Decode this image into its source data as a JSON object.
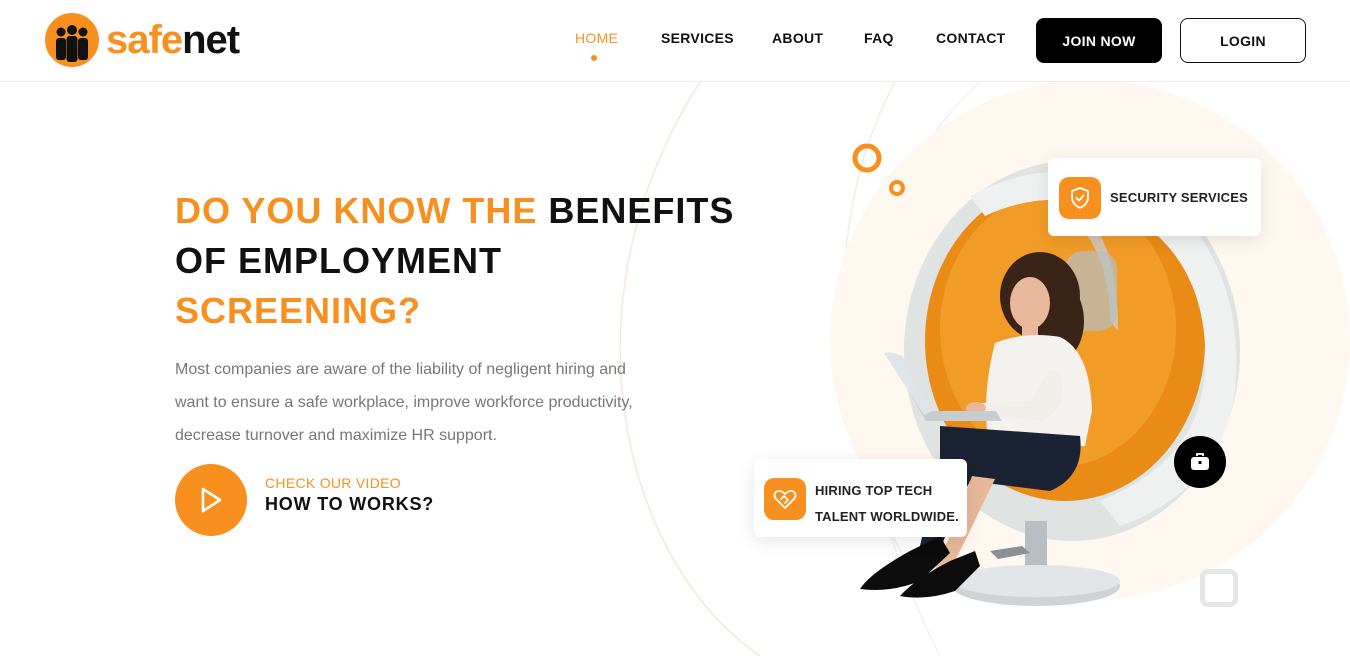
{
  "brand": {
    "part1": "safe",
    "part2": "net",
    "accent": "#f7901e",
    "dark": "#111111"
  },
  "nav": {
    "items": [
      {
        "label": "HOME",
        "active": true
      },
      {
        "label": "SERVICES",
        "active": false
      },
      {
        "label": "ABOUT",
        "active": false
      },
      {
        "label": "FAQ",
        "active": false
      },
      {
        "label": "CONTACT",
        "active": false
      }
    ],
    "join_label": "JOIN NOW",
    "login_label": "LOGIN"
  },
  "hero": {
    "title_orange_1": "DO YOU KNOW THE",
    "title_dark": "BENEFITS OF EMPLOYMENT",
    "title_orange_2": "SCREENING?",
    "description": "Most companies are aware of the liability of negligent hiring and want to ensure a safe workplace, improve workforce productivity, decrease turnover and maximize HR support.",
    "video_eyebrow": "CHECK OUR VIDEO",
    "video_title": "HOW TO WORKS?"
  },
  "cards": {
    "security": {
      "label": "SECURITY SERVICES",
      "icon": "shield-check-icon"
    },
    "hiring": {
      "line1": "HIRING TOP TECH",
      "line2": "TALENT WORLDWIDE.",
      "icon": "heart-handshake-icon"
    }
  },
  "icons": {
    "play": "play-icon",
    "bag": "briefcase-icon"
  }
}
